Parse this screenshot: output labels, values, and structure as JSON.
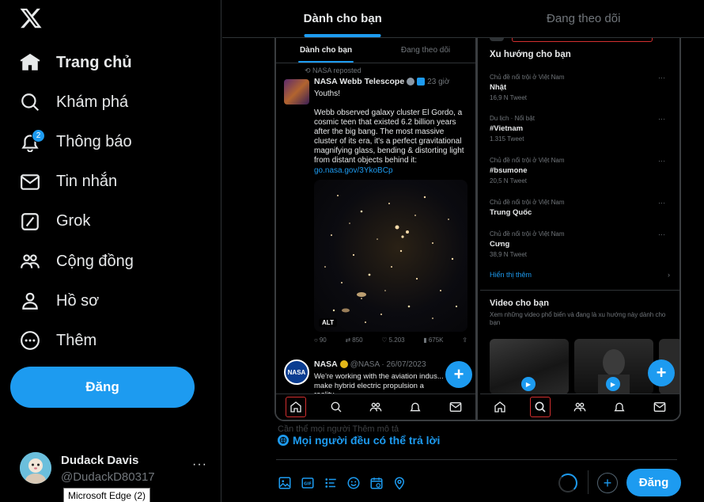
{
  "sidebar": {
    "logo": "x-logo-icon",
    "nav": [
      {
        "label": "Trang chủ",
        "icon": "home-icon",
        "active": true
      },
      {
        "label": "Khám phá",
        "icon": "search-icon"
      },
      {
        "label": "Thông báo",
        "icon": "bell-icon",
        "badge": "2"
      },
      {
        "label": "Tin nhắn",
        "icon": "mail-icon"
      },
      {
        "label": "Grok",
        "icon": "grok-icon"
      },
      {
        "label": "Cộng đồng",
        "icon": "communities-icon"
      },
      {
        "label": "Hồ sơ",
        "icon": "profile-icon"
      },
      {
        "label": "Thêm",
        "icon": "more-circle-icon"
      }
    ],
    "post_button": "Đăng",
    "account": {
      "name": "Dudack Davis",
      "handle": "@DudackD80317",
      "more": "···"
    }
  },
  "tooltip": "Microsoft Edge (2)",
  "main": {
    "tabs": [
      {
        "label": "Dành cho bạn",
        "active": true
      },
      {
        "label": "Đang theo dõi"
      }
    ],
    "reply_restriction": "Mọi người đều có thể trả lời",
    "faded_text": "Cần thể mọi người                Thêm mô tả",
    "submit_label": "Đăng",
    "add_label": "+"
  },
  "embedded": {
    "left": {
      "tabs": [
        "Dành cho bạn",
        "Đang theo dõi"
      ],
      "tweet": {
        "repost": "NASA reposted",
        "name": "NASA Webb Telescope",
        "time": "23 giờ",
        "text": "Youths!\n\nWebb observed galaxy cluster El Gordo, a cosmic teen that existed 6.2 billion years after the big bang. The most massive cluster of its era, it's a perfect gravitational magnifying glass, bending & distorting light from distant objects behind it:",
        "link": "go.nasa.gov/3YkoBCp",
        "alt": "ALT",
        "actions": [
          "90",
          "850",
          "5.203",
          "675K",
          ""
        ]
      },
      "tweet2": {
        "avatar": "NASA",
        "name": "NASA",
        "handle": "@NASA · 26/07/2023",
        "text": "We're working with the aviation indus... make hybrid electric propulsion a reality..."
      },
      "fab": "+"
    },
    "right": {
      "title": "Xu hướng cho bạn",
      "trends": [
        {
          "cat": "Chủ đề nổi trội ở Việt Nam",
          "name": "Nhật",
          "count": "16,9 N Tweet"
        },
        {
          "cat": "Du lịch · Nổi bật",
          "name": "#Vietnam",
          "count": "1.315 Tweet"
        },
        {
          "cat": "Chủ đề nổi trội ở Việt Nam",
          "name": "#bsumone",
          "count": "20,5 N Tweet"
        },
        {
          "cat": "Chủ đề nổi trội ở Việt Nam",
          "name": "Trung Quốc",
          "count": ""
        },
        {
          "cat": "Chủ đề nổi trội ở Việt Nam",
          "name": "Cưng",
          "count": "38,9 N Tweet"
        }
      ],
      "show_more": "Hiển thị thêm",
      "video_title": "Video cho bạn",
      "video_sub": "Xem những video phổ biến và đang là xu hướng này dành cho bạn",
      "fab": "+"
    }
  },
  "colors": {
    "accent": "#1d9bf0",
    "bg": "#000000",
    "border": "#2f3336",
    "muted": "#71767b",
    "highlight": "#d32f2f"
  }
}
